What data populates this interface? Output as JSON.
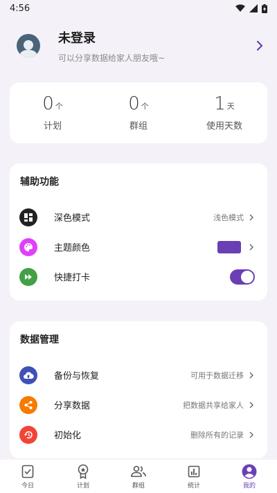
{
  "status_bar": {
    "time": "4:56"
  },
  "profile": {
    "name": "未登录",
    "subtitle": "可以分享数据给家人朋友哦~"
  },
  "stats": [
    {
      "value": "0",
      "unit": "个",
      "label": "计划"
    },
    {
      "value": "0",
      "unit": "个",
      "label": "群组"
    },
    {
      "value": "1",
      "unit": "天",
      "label": "使用天数"
    }
  ],
  "assist": {
    "title": "辅助功能",
    "dark_mode": {
      "label": "深色模式",
      "value": "浅色模式"
    },
    "theme_color": {
      "label": "主题颜色",
      "color": "#6a3fb5"
    },
    "quick_checkin": {
      "label": "快捷打卡",
      "enabled": true
    }
  },
  "data_mgmt": {
    "title": "数据管理",
    "backup": {
      "label": "备份与恢复",
      "value": "可用于数据迁移"
    },
    "share": {
      "label": "分享数据",
      "value": "把数据共享给家人"
    },
    "reset": {
      "label": "初始化",
      "value": "删除所有的记录"
    }
  },
  "nav": {
    "today": "今日",
    "plan": "计划",
    "group": "群组",
    "stats": "统计",
    "mine": "我的"
  },
  "colors": {
    "accent": "#6a3fb5",
    "dark_icon": "#222222",
    "theme_icon": "#e040fb",
    "quick_icon": "#43a047",
    "backup_icon": "#3f51b5",
    "share_icon": "#f57c00",
    "reset_icon": "#f44336"
  }
}
